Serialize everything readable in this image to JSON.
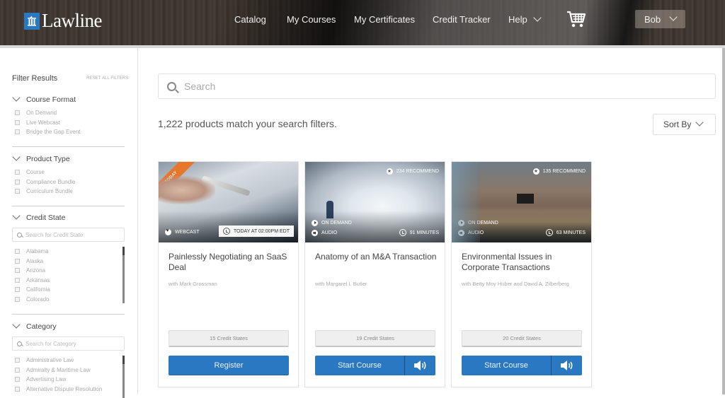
{
  "header": {
    "logo_mark": "m",
    "logo_text": "Lawline",
    "nav": [
      "Catalog",
      "My Courses",
      "My Certificates",
      "Credit Tracker",
      "Help"
    ],
    "cart_icon": "shopping-cart-icon",
    "user": "Bob"
  },
  "sidebar": {
    "title": "Filter Results",
    "reset": "RESET ALL FILTERS",
    "sections": [
      {
        "title": "Course Format",
        "options": [
          "On Demand",
          "Live Webcast",
          "Bridge the Gap Event"
        ]
      },
      {
        "title": "Product Type",
        "options": [
          "Course",
          "Compliance Bundle",
          "Curriculum Bundle"
        ]
      },
      {
        "title": "Credit State",
        "search_placeholder": "Search for Credit State",
        "options": [
          "Alabama",
          "Alaska",
          "Arizona",
          "Arkansas",
          "California",
          "Colorado"
        ]
      },
      {
        "title": "Category",
        "search_placeholder": "Search for Category",
        "options": [
          "Administrative Law",
          "Admiralty & Maritime Law",
          "Advertising Law",
          "Alternative Dispute Resolution"
        ]
      }
    ]
  },
  "main": {
    "search_placeholder": "Search",
    "result_count": "1,222 products match your search filters.",
    "sort_label": "Sort By",
    "cards": [
      {
        "ribbon": "TODAY",
        "format": "WEBCAST",
        "time": "TODAY AT 02:00PM EDT",
        "title": "Painlessly Negotiating an SaaS Deal",
        "author": "with Mark Grossman",
        "credit_states": "15 Credit States",
        "action": "Register"
      },
      {
        "recommend": "234 RECOMMEND",
        "format": "ON DEMAND",
        "media": "AUDIO",
        "duration": "91 MINUTES",
        "title": "Anatomy of an M&A Transaction",
        "author": "with Margaret I. Butler",
        "credit_states": "19 Credit States",
        "action": "Start Course"
      },
      {
        "recommend": "135 RECOMMEND",
        "format": "ON DEMAND",
        "media": "AUDIO",
        "duration": "63 MINUTES",
        "title": "Environmental Issues in Corporate Transactions",
        "author": "with Betty Moy Huber and David A. Zilberberg",
        "credit_states": "20 Credit States",
        "action": "Start Course"
      }
    ]
  },
  "colors": {
    "brand_blue": "#2a78c2",
    "ribbon_orange": "#e8772e"
  }
}
